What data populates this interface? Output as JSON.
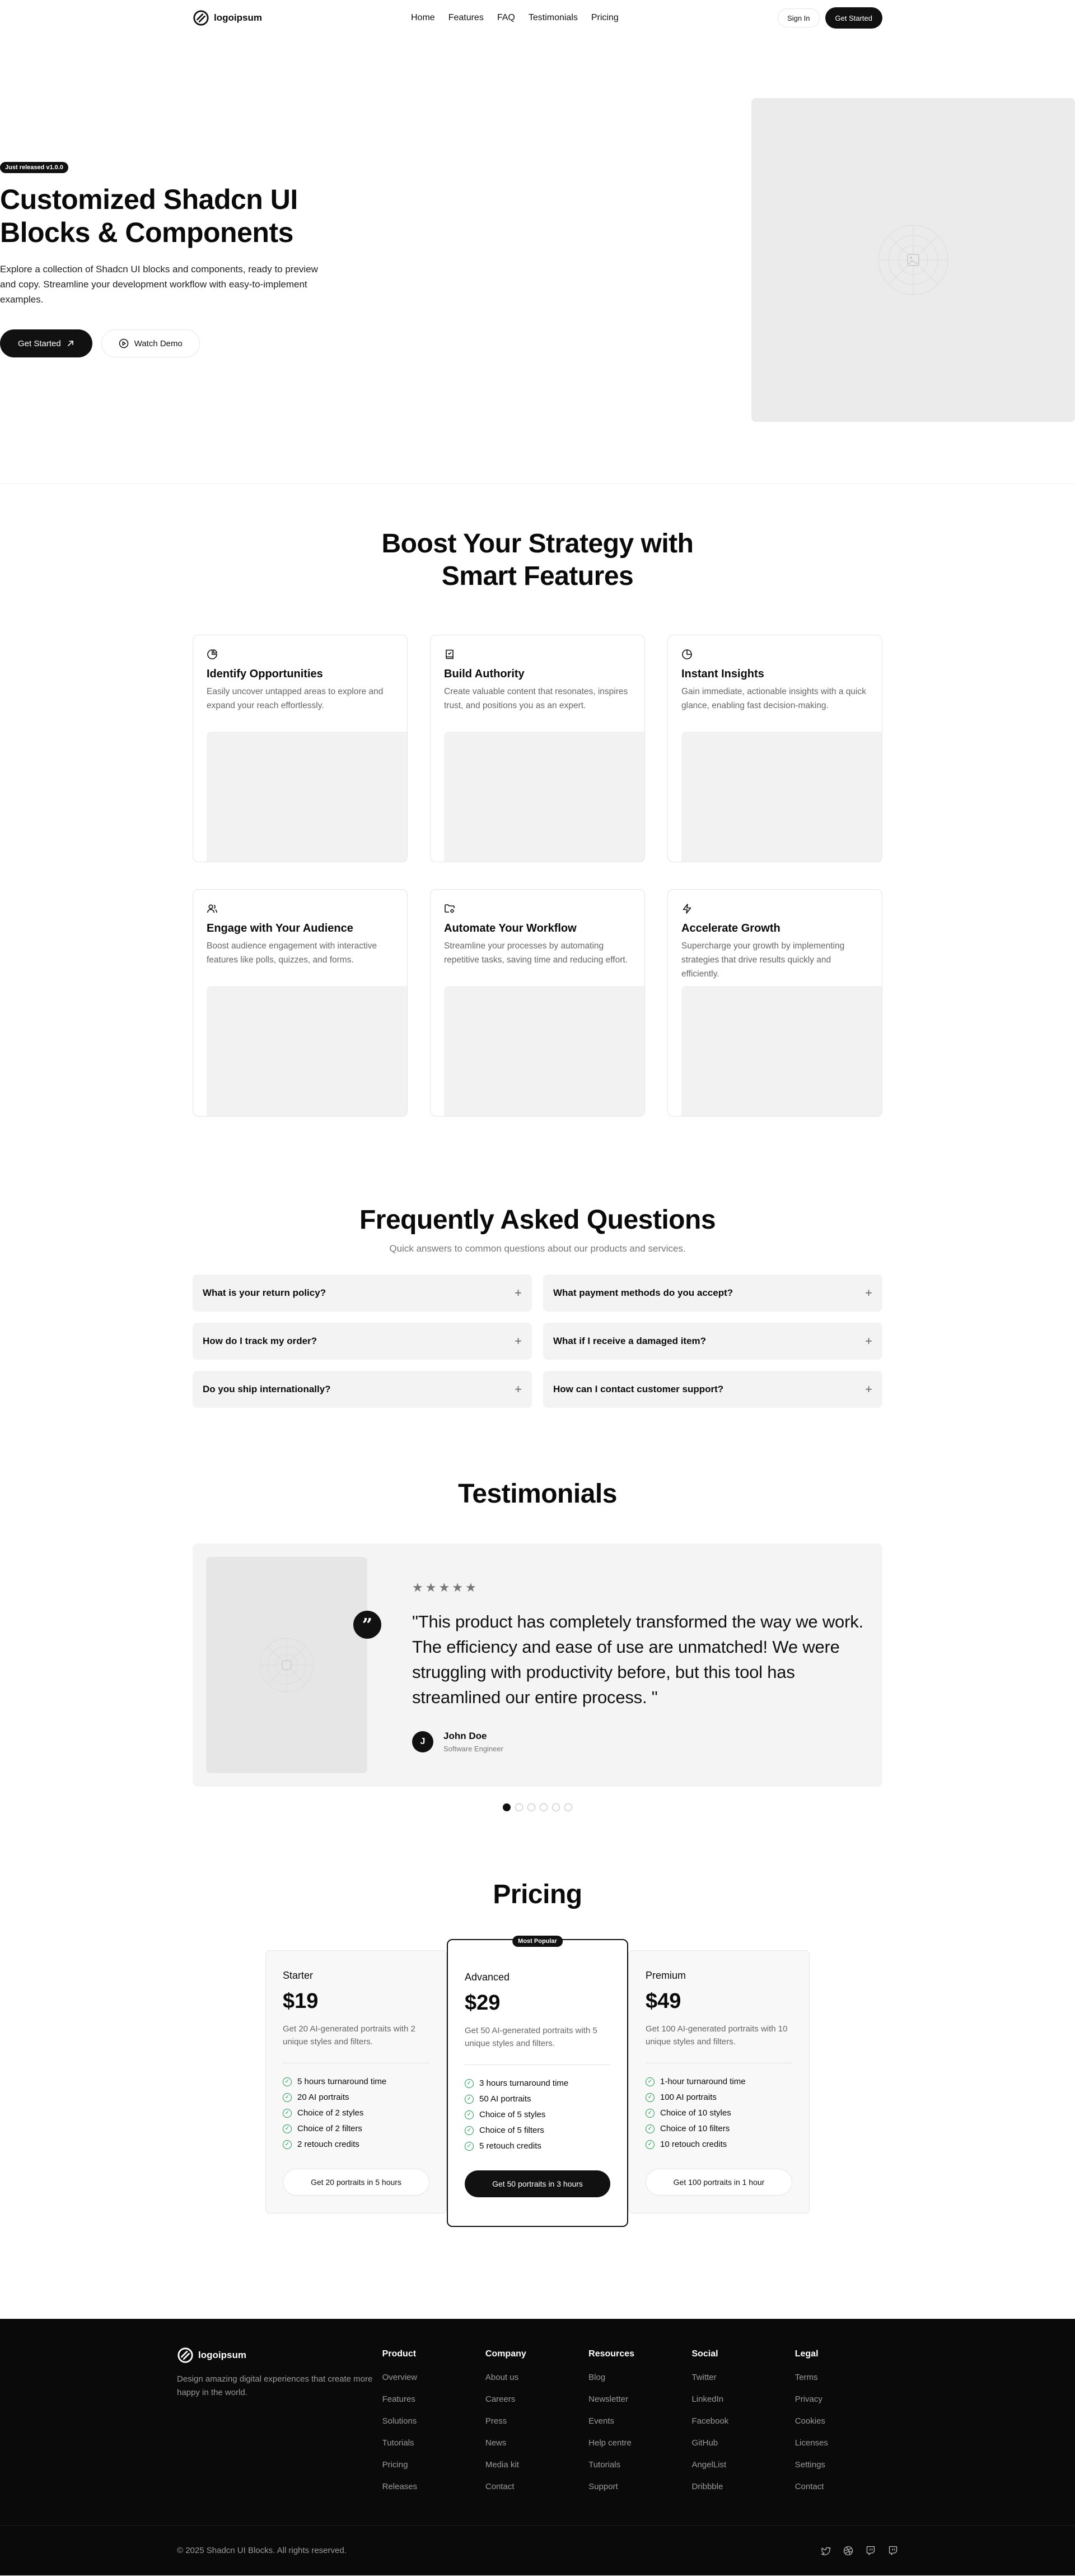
{
  "nav": {
    "logo": "logoipsum",
    "links": [
      "Home",
      "Features",
      "FAQ",
      "Testimonials",
      "Pricing"
    ],
    "signin": "Sign In",
    "get_started": "Get Started"
  },
  "hero": {
    "badge": "Just released v1.0.0",
    "title_line1": "Customized Shadcn UI",
    "title_line2": "Blocks & Components",
    "description": "Explore a collection of Shadcn UI blocks and components, ready to preview and copy. Streamline your development workflow with easy-to-implement examples.",
    "primary_cta": "Get Started",
    "secondary_cta": "Watch Demo"
  },
  "features": {
    "title_line1": "Boost Your Strategy with",
    "title_line2": "Smart Features",
    "items": [
      {
        "title": "Identify Opportunities",
        "desc": "Easily uncover untapped areas to explore and expand your reach effortlessly."
      },
      {
        "title": "Build Authority",
        "desc": "Create valuable content that resonates, inspires trust, and positions you as an expert."
      },
      {
        "title": "Instant Insights",
        "desc": "Gain immediate, actionable insights with a quick glance, enabling fast decision-making."
      },
      {
        "title": "Engage with Your Audience",
        "desc": "Boost audience engagement with interactive features like polls, quizzes, and forms."
      },
      {
        "title": "Automate Your Workflow",
        "desc": "Streamline your processes by automating repetitive tasks, saving time and reducing effort."
      },
      {
        "title": "Accelerate Growth",
        "desc": "Supercharge your growth by implementing strategies that drive results quickly and efficiently."
      }
    ]
  },
  "faq": {
    "title": "Frequently Asked Questions",
    "subtitle": "Quick answers to common questions about our products and services.",
    "items": [
      "What is your return policy?",
      "What payment methods do you accept?",
      "How do I track my order?",
      "What if I receive a damaged item?",
      "Do you ship internationally?",
      "How can I contact customer support?"
    ]
  },
  "testimonials": {
    "title": "Testimonials",
    "quote": "\"This product has completely transformed the way we work. The efficiency and ease of use are unmatched! We were struggling with productivity before, but this tool has streamlined our entire process. \"",
    "author": "John Doe",
    "role": "Software Engineer",
    "avatar_initial": "J",
    "rating": 5,
    "slide_count": 6,
    "active_slide": 1
  },
  "pricing": {
    "title": "Pricing",
    "popular_badge": "Most Popular",
    "plans": [
      {
        "name": "Starter",
        "price": "$19",
        "desc": "Get 20 AI-generated portraits with 2 unique styles and filters.",
        "features": [
          "5 hours turnaround time",
          "20 AI portraits",
          "Choice of 2 styles",
          "Choice of 2 filters",
          "2 retouch credits"
        ],
        "cta": "Get 20 portraits in 5 hours"
      },
      {
        "name": "Advanced",
        "price": "$29",
        "desc": "Get 50 AI-generated portraits with 5 unique styles and filters.",
        "features": [
          "3 hours turnaround time",
          "50 AI portraits",
          "Choice of 5 styles",
          "Choice of 5 filters",
          "5 retouch credits"
        ],
        "cta": "Get 50 portraits in 3 hours"
      },
      {
        "name": "Premium",
        "price": "$49",
        "desc": "Get 100 AI-generated portraits with 10 unique styles and filters.",
        "features": [
          "1-hour turnaround time",
          "100 AI portraits",
          "Choice of 10 styles",
          "Choice of 10 filters",
          "10 retouch credits"
        ],
        "cta": "Get 100 portraits in 1 hour"
      }
    ]
  },
  "footer": {
    "logo": "logoipsum",
    "tagline": "Design amazing digital experiences that create more happy in the world.",
    "columns": [
      {
        "title": "Product",
        "links": [
          "Overview",
          "Features",
          "Solutions",
          "Tutorials",
          "Pricing",
          "Releases"
        ]
      },
      {
        "title": "Company",
        "links": [
          "About us",
          "Careers",
          "Press",
          "News",
          "Media kit",
          "Contact"
        ]
      },
      {
        "title": "Resources",
        "links": [
          "Blog",
          "Newsletter",
          "Events",
          "Help centre",
          "Tutorials",
          "Support"
        ]
      },
      {
        "title": "Social",
        "links": [
          "Twitter",
          "LinkedIn",
          "Facebook",
          "GitHub",
          "AngelList",
          "Dribbble"
        ]
      },
      {
        "title": "Legal",
        "links": [
          "Terms",
          "Privacy",
          "Cookies",
          "Licenses",
          "Settings",
          "Contact"
        ]
      }
    ],
    "copyright": "© 2025 Shadcn UI Blocks. All rights reserved.",
    "socials": [
      "twitter-icon",
      "dribbble-icon",
      "twitch-icon",
      "twitch-icon"
    ]
  },
  "colors": {
    "primary": "#111111",
    "muted_bg": "#f3f3f3",
    "check_green": "#1a9a4a",
    "footer_bg": "#0a0a0a"
  }
}
